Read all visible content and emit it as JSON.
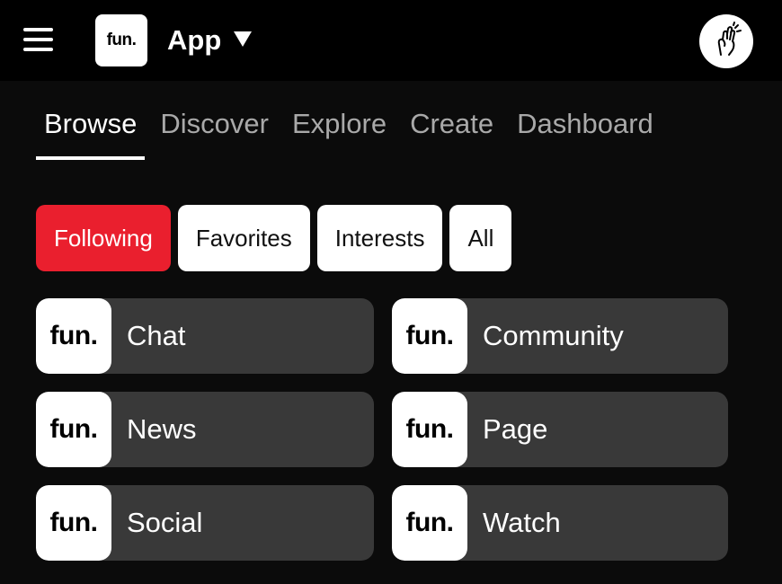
{
  "header": {
    "logo_text": "fun.",
    "app_title": "App",
    "menu_icon": "hamburger-menu-icon",
    "caret_icon": "caret-down-icon",
    "avatar_icon": "hand-gesture-avatar"
  },
  "tabs": [
    {
      "label": "Browse",
      "active": true
    },
    {
      "label": "Discover",
      "active": false
    },
    {
      "label": "Explore",
      "active": false
    },
    {
      "label": "Create",
      "active": false
    },
    {
      "label": "Dashboard",
      "active": false
    }
  ],
  "filters": [
    {
      "label": "Following",
      "active": true
    },
    {
      "label": "Favorites",
      "active": false
    },
    {
      "label": "Interests",
      "active": false
    },
    {
      "label": "All",
      "active": false
    }
  ],
  "cards": [
    {
      "logo": "fun.",
      "label": "Chat"
    },
    {
      "logo": "fun.",
      "label": "Community"
    },
    {
      "logo": "fun.",
      "label": "News"
    },
    {
      "logo": "fun.",
      "label": "Page"
    },
    {
      "logo": "fun.",
      "label": "Social"
    },
    {
      "logo": "fun.",
      "label": "Watch"
    }
  ],
  "colors": {
    "accent": "#ea1f2e",
    "background": "#0b0b0b",
    "topbar": "#000000",
    "card": "#393939",
    "inactive_tab": "#a9a9a9"
  }
}
